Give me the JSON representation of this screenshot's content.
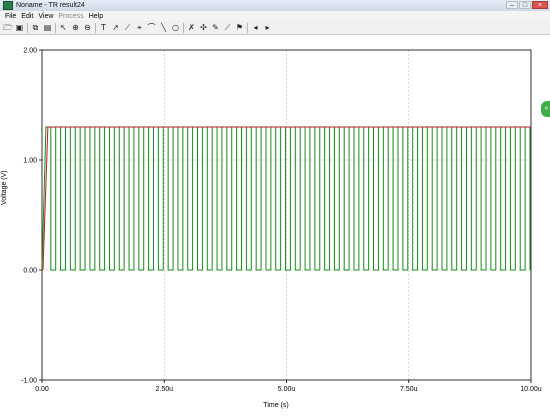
{
  "window": {
    "title": "Noname - TR result24",
    "controls": [
      "–",
      "□",
      "×"
    ]
  },
  "menu": [
    {
      "label": "File",
      "enabled": true
    },
    {
      "label": "Edit",
      "enabled": true
    },
    {
      "label": "View",
      "enabled": true
    },
    {
      "label": "Process",
      "enabled": false
    },
    {
      "label": "Help",
      "enabled": true
    }
  ],
  "toolbar": {
    "buttons": [
      {
        "name": "open-icon",
        "glyph": "🗁"
      },
      {
        "name": "save-icon",
        "glyph": "▣"
      },
      {
        "name": "copy-icon",
        "glyph": "⧉"
      },
      {
        "name": "paste-icon",
        "glyph": "▤"
      },
      {
        "name": "pointer-icon",
        "glyph": "↖"
      },
      {
        "name": "zoom-in-icon",
        "glyph": "⊕"
      },
      {
        "name": "zoom-out-icon",
        "glyph": "⊖"
      },
      {
        "name": "text-icon",
        "glyph": "T"
      },
      {
        "name": "cursor-probe-icon",
        "glyph": "↗"
      },
      {
        "name": "line-probe-icon",
        "glyph": "⟋"
      },
      {
        "name": "marker-icon",
        "glyph": "⌖"
      },
      {
        "name": "curve-icon",
        "glyph": "⌒"
      },
      {
        "name": "line-icon",
        "glyph": "╲"
      },
      {
        "name": "circle-icon",
        "glyph": "○"
      },
      {
        "name": "x-cursor-icon",
        "glyph": "✗"
      },
      {
        "name": "y-cursor-icon",
        "glyph": "✣"
      },
      {
        "name": "measure-icon",
        "glyph": "✎"
      },
      {
        "name": "slope-icon",
        "glyph": "⟋"
      },
      {
        "name": "flag-icon",
        "glyph": "⚑"
      },
      {
        "name": "prev-icon",
        "glyph": "◂"
      },
      {
        "name": "next-icon",
        "glyph": "▸"
      }
    ]
  },
  "side_handle_label": "«",
  "colors": {
    "green_trace": "#1a8a1a",
    "red_trace": "#b01e1e",
    "grid": "#b8b8b8",
    "axis": "#000000"
  },
  "chart_data": {
    "type": "line",
    "xlabel": "Time (s)",
    "ylabel": "Voltage (V)",
    "xlim": [
      0,
      10
    ],
    "ylim": [
      -1,
      2
    ],
    "x_ticks": [
      "0.00",
      "2.50u",
      "5.00u",
      "7.50u",
      "10.00u"
    ],
    "x_tick_values": [
      0,
      2.5,
      5,
      7.5,
      10
    ],
    "y_ticks": [
      "2.00",
      "1.00",
      "0.00",
      "-1.00"
    ],
    "y_tick_values": [
      2,
      1,
      0,
      -1
    ],
    "grid": true,
    "series": [
      {
        "kind": "square",
        "color": "green",
        "start": 0.08,
        "period": 0.2,
        "high_fraction": 0.5,
        "high": 1.3,
        "low": 0.0,
        "rise_start": 0.0,
        "rise_end": 0.08
      },
      {
        "kind": "flat",
        "color": "red",
        "value": 1.3,
        "rise_start": 0.02,
        "rise_end": 0.12
      }
    ]
  }
}
